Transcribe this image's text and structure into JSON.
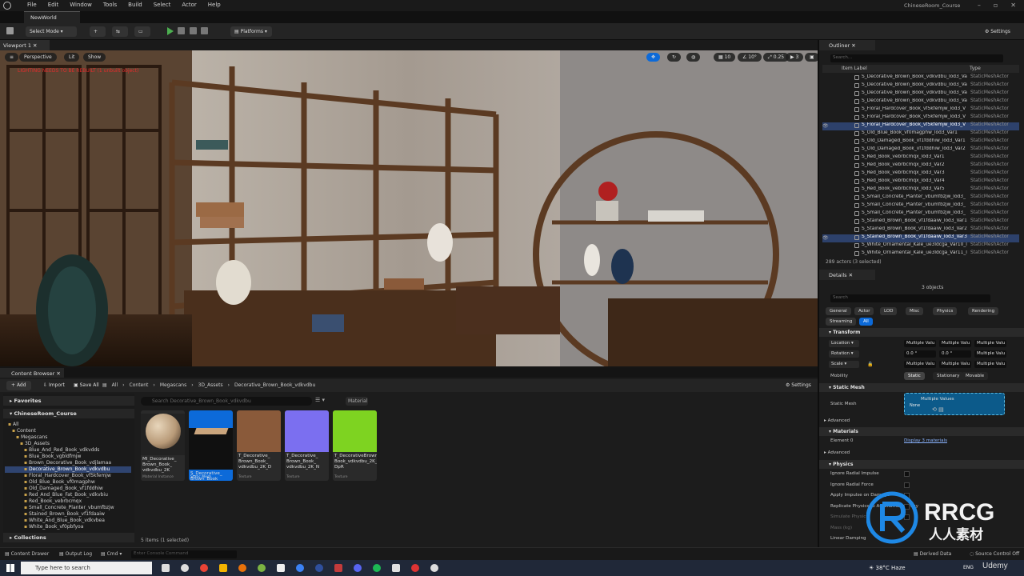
{
  "menubar": {
    "items": [
      "File",
      "Edit",
      "Window",
      "Tools",
      "Build",
      "Select",
      "Actor",
      "Help"
    ],
    "project": "ChineseRoom_Course"
  },
  "tabs": {
    "level": "NewWorld"
  },
  "toolbar": {
    "select_mode": "Select Mode",
    "platforms": "Platforms",
    "settings": "Settings"
  },
  "viewport": {
    "tab": "Viewport 1",
    "perspective": "Perspective",
    "lit": "Lit",
    "show": "Show",
    "warning": "LIGHTING NEEDS TO BE REBUILT (1 unbuilt object)",
    "grid_value": "10",
    "rotation_value": "10°",
    "scale_value": "0.25",
    "camera_speed": "3"
  },
  "content_browser": {
    "tab": "Content Browser",
    "add": "Add",
    "import": "Import",
    "save_all": "Save All",
    "breadcrumb": [
      "All",
      "Content",
      "Megascans",
      "3D_Assets",
      "Decorative_Brown_Book_vdkvdbu"
    ],
    "settings": "Settings",
    "favorites": "Favorites",
    "project": "ChineseRoom_Course",
    "tree": [
      {
        "label": "All",
        "depth": 0
      },
      {
        "label": "Content",
        "depth": 1
      },
      {
        "label": "Megascans",
        "depth": 2
      },
      {
        "label": "3D_Assets",
        "depth": 3
      },
      {
        "label": "Blue_And_Red_Book_vdkvdds",
        "depth": 4
      },
      {
        "label": "Blue_Book_vgbldfmjw",
        "depth": 4
      },
      {
        "label": "Brown_Decorative_Book_vdjlamaa",
        "depth": 4
      },
      {
        "label": "Decorative_Brown_Book_vdkvdbu",
        "depth": 4,
        "selected": true
      },
      {
        "label": "Floral_Hardcover_Book_vf5kfemjw",
        "depth": 4
      },
      {
        "label": "Old_Blue_Book_vf0magphw",
        "depth": 4
      },
      {
        "label": "Old_Damaged_Book_vf1fddhiw",
        "depth": 4
      },
      {
        "label": "Red_And_Blue_Fat_Book_vdkvbiu",
        "depth": 4
      },
      {
        "label": "Red_Book_vebrbcmqx",
        "depth": 4
      },
      {
        "label": "Small_Concrete_Planter_vbumfbzjw",
        "depth": 4
      },
      {
        "label": "Stained_Brown_Book_vf1fdaaiw",
        "depth": 4
      },
      {
        "label": "White_And_Blue_Book_vdkvbea",
        "depth": 4
      },
      {
        "label": "White_Book_vf0pbfyoa",
        "depth": 4
      }
    ],
    "collections": "Collections",
    "search_placeholder": "Search Decorative_Brown_Book_vdkvdbu",
    "filter_chip": "Material",
    "assets": [
      {
        "label": "MI_Decorative_\nBrown_Book_\nvdkvdbu_2K",
        "type": "Material Instance",
        "color": "#b89a78"
      },
      {
        "label": "S_Decorative_\nBrown_Book_\nvdkvdbu_lod3_...",
        "type": "Static Mesh",
        "color": "#101010",
        "selected": true
      },
      {
        "label": "T_Decorative_\nBrown_Book_\nvdkvdbu_2K_D",
        "type": "Texture",
        "color": "#8a5a3a"
      },
      {
        "label": "T_Decorative_\nBrown_Book_\nvdkvdbu_2K_N",
        "type": "Texture",
        "color": "#7b6ff0"
      },
      {
        "label": "T_DecorativeBrown\nBook_vdkvdbu_2K_\nDpR",
        "type": "Texture",
        "color": "#7ed321"
      }
    ],
    "item_count": "5 items (1 selected)"
  },
  "outliner": {
    "tab": "Outliner",
    "search_placeholder": "Search...",
    "col_label": "Item Label",
    "col_type": "Type",
    "rows": [
      {
        "name": "S_Decorative_Brown_Book_vdkvdbu_lod3_Va",
        "type": "StaticMeshActor"
      },
      {
        "name": "S_Decorative_Brown_Book_vdkvdbu_lod3_Va",
        "type": "StaticMeshActor"
      },
      {
        "name": "S_Decorative_Brown_Book_vdkvdbu_lod3_Va",
        "type": "StaticMeshActor"
      },
      {
        "name": "S_Decorative_Brown_Book_vdkvdbu_lod3_Va",
        "type": "StaticMeshActor"
      },
      {
        "name": "S_Floral_Hardcover_Book_vf5kfemjw_lod3_V",
        "type": "StaticMeshActor"
      },
      {
        "name": "S_Floral_Hardcover_Book_vf5kfemjw_lod3_V",
        "type": "StaticMeshActor"
      },
      {
        "name": "S_Floral_Hardcover_Book_vf5kfemjw_lod3_V",
        "type": "StaticMeshActor",
        "selected": true
      },
      {
        "name": "S_Old_Blue_Book_vf0magphw_lod3_Var1",
        "type": "StaticMeshActor"
      },
      {
        "name": "S_Old_Damaged_Book_vf1fddhiw_lod3_Var1",
        "type": "StaticMeshActor"
      },
      {
        "name": "S_Old_Damaged_Book_vf1fddhiw_lod3_Var2",
        "type": "StaticMeshActor"
      },
      {
        "name": "S_Red_Book_vebrbcmqx_lod3_Var1",
        "type": "StaticMeshActor"
      },
      {
        "name": "S_Red_Book_vebrbcmqx_lod3_Var2",
        "type": "StaticMeshActor"
      },
      {
        "name": "S_Red_Book_vebrbcmqx_lod3_Var3",
        "type": "StaticMeshActor"
      },
      {
        "name": "S_Red_Book_vebrbcmqx_lod3_Var4",
        "type": "StaticMeshActor"
      },
      {
        "name": "S_Red_Book_vebrbcmqx_lod3_Var5",
        "type": "StaticMeshActor"
      },
      {
        "name": "S_Small_Concrete_Planter_vbumfbzjw_lod3_",
        "type": "StaticMeshActor"
      },
      {
        "name": "S_Small_Concrete_Planter_vbumfbzjw_lod3_",
        "type": "StaticMeshActor"
      },
      {
        "name": "S_Small_Concrete_Planter_vbumfbzjw_lod3_",
        "type": "StaticMeshActor"
      },
      {
        "name": "S_Stained_Brown_Book_vf1fdaaiw_lod3_Var1",
        "type": "StaticMeshActor"
      },
      {
        "name": "S_Stained_Brown_Book_vf1fdaaiw_lod3_Var2",
        "type": "StaticMeshActor"
      },
      {
        "name": "S_Stained_Brown_Book_vf1fdaaiw_lod3_Var3",
        "type": "StaticMeshActor",
        "selected": true
      },
      {
        "name": "S_White_Ornamental_Kale_ue3ldcga_Var10_l",
        "type": "StaticMeshActor"
      },
      {
        "name": "S_White_Ornamental_Kale_ue3ldcga_Var11_l",
        "type": "StaticMeshActor"
      }
    ],
    "actor_count": "289 actors (3 selected)"
  },
  "details": {
    "tab": "Details",
    "object_count": "3 objects",
    "search_placeholder": "Search",
    "filters": [
      "General",
      "Actor",
      "LOD",
      "Misc",
      "Physics",
      "Rendering",
      "Streaming",
      "All"
    ],
    "transform": "Transform",
    "location": "Location",
    "rotation": "Rotation",
    "scale": "Scale",
    "multiple": "Multiple Values",
    "multiple_short": "Multiple Valu",
    "zero": "0.0 °",
    "mobility": "Mobility",
    "mobility_opts": [
      "Static",
      "Stationary",
      "Movable"
    ],
    "static_mesh_section": "Static Mesh",
    "static_mesh_label": "Static Mesh",
    "static_mesh_value": "Multiple Values",
    "none": "None",
    "advanced": "Advanced",
    "materials": "Materials",
    "element0": "Element 0",
    "display_materials": "Display 3 materials",
    "physics": "Physics",
    "physics_rows": [
      "Ignore Radial Impulse",
      "Ignore Radial Force",
      "Apply Impulse on Damage",
      "Replicate Physics to Autonomous Proxy",
      "Simulate Physics",
      "Mass (kg)",
      "Linear Damping"
    ]
  },
  "statusbar": {
    "content_drawer": "Content Drawer",
    "output_log": "Output Log",
    "cmd": "Cmd",
    "console_placeholder": "Enter Console Command",
    "derived_data": "Derived Data",
    "source_control": "Source Control Off"
  },
  "taskbar": {
    "search": "Type here to search",
    "weather": "38°C  Haze",
    "lang": "ENG"
  },
  "watermark": {
    "brand": "RRCG",
    "sub": "人人素材",
    "udemy": "Udemy"
  }
}
